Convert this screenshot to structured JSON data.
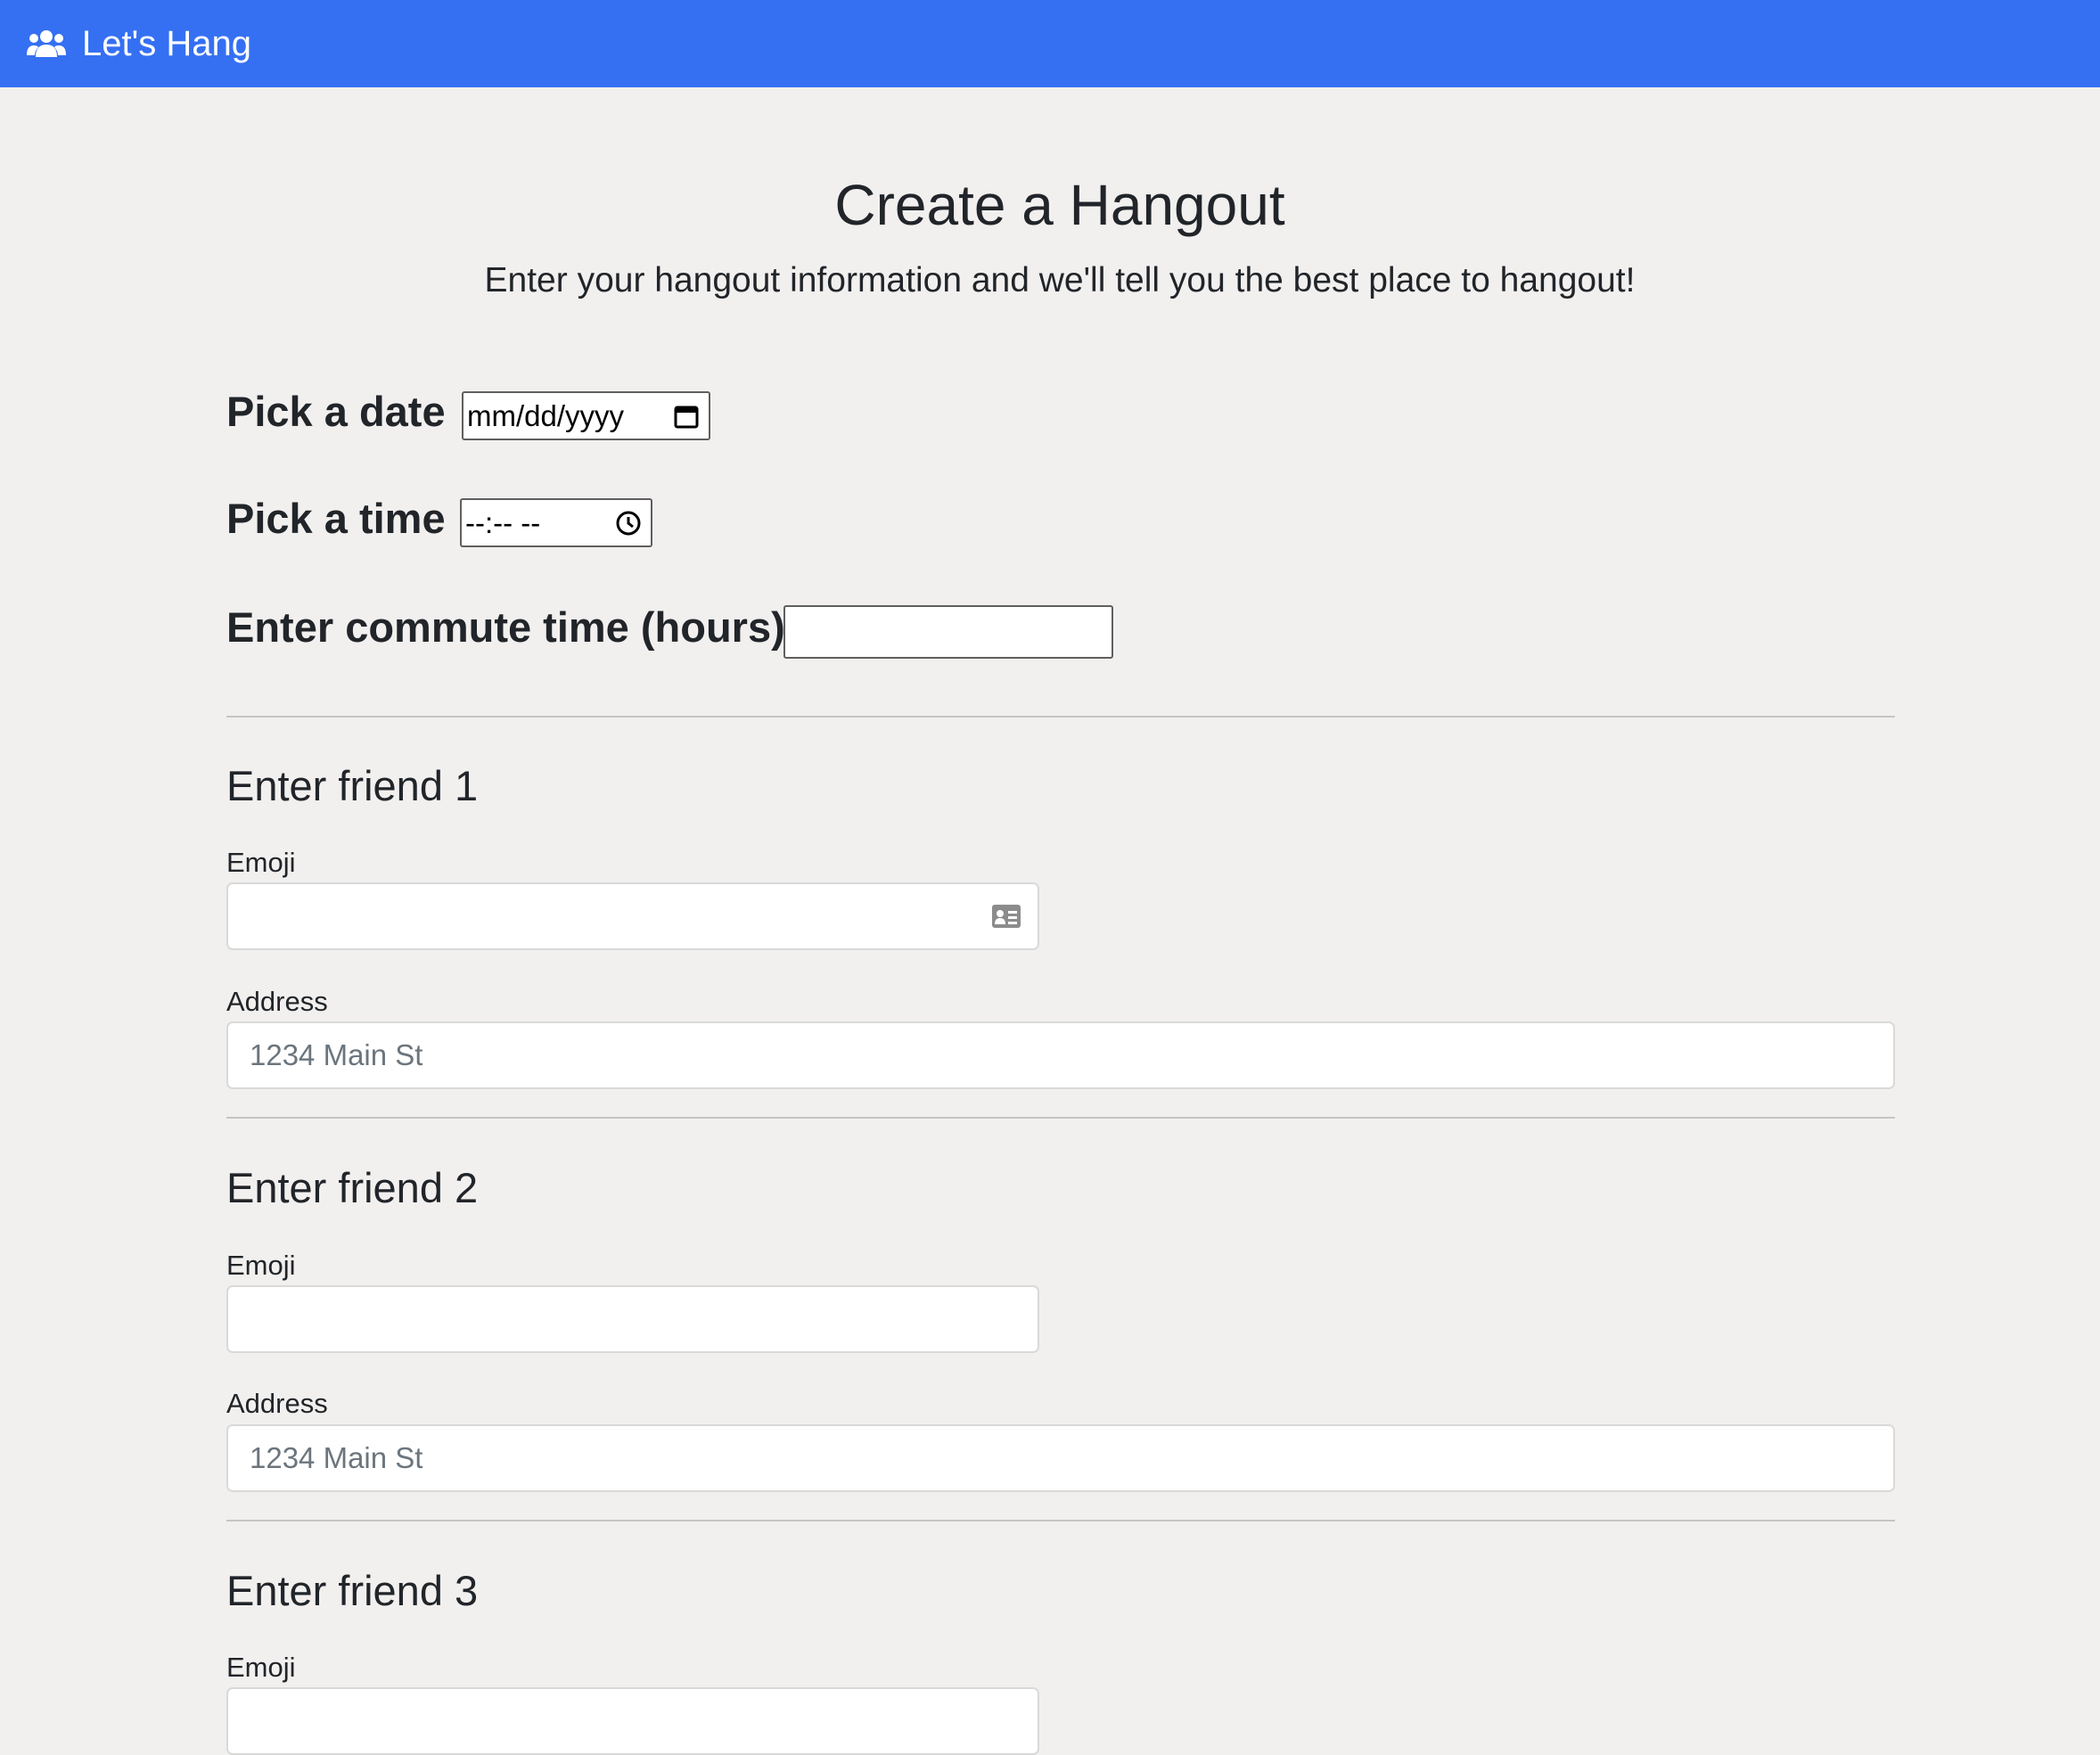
{
  "navbar": {
    "brand_icon": "users-icon",
    "brand_label": "Let's Hang",
    "background": "#3570f3"
  },
  "header": {
    "title": "Create a Hangout",
    "subtitle": "Enter your hangout information and we'll tell you the best place to hangout!"
  },
  "form": {
    "date": {
      "label": "Pick a date",
      "placeholder": "mm/dd/yyyy",
      "icon": "calendar-icon"
    },
    "time": {
      "label": "Pick a time",
      "placeholder": "--:-- --",
      "icon": "clock-icon"
    },
    "commute": {
      "label": "Enter commute time (hours)",
      "value": ""
    }
  },
  "friends": [
    {
      "heading": "Enter friend 1",
      "emoji_label": "Emoji",
      "emoji_value": "",
      "address_label": "Address",
      "address_placeholder": "1234 Main St"
    },
    {
      "heading": "Enter friend 2",
      "emoji_label": "Emoji",
      "emoji_value": "",
      "address_label": "Address",
      "address_placeholder": "1234 Main St"
    },
    {
      "heading": "Enter friend 3",
      "emoji_label": "Emoji",
      "emoji_value": ""
    }
  ]
}
